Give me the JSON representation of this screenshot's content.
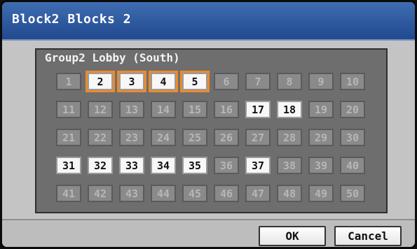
{
  "dialog": {
    "title": "Block2 Blocks 2",
    "group_label": "Group2 Lobby (South)"
  },
  "grid": {
    "units": [
      "1",
      "2",
      "3",
      "4",
      "5",
      "6",
      "7",
      "8",
      "9",
      "10",
      "11",
      "12",
      "13",
      "14",
      "15",
      "16",
      "17",
      "18",
      "19",
      "20",
      "21",
      "22",
      "23",
      "24",
      "25",
      "26",
      "27",
      "28",
      "29",
      "30",
      "31",
      "32",
      "33",
      "34",
      "35",
      "36",
      "37",
      "38",
      "39",
      "40",
      "41",
      "42",
      "43",
      "44",
      "45",
      "46",
      "47",
      "48",
      "49",
      "50"
    ],
    "active": [
      2,
      3,
      4,
      5,
      17,
      18,
      31,
      32,
      33,
      34,
      35,
      37
    ],
    "selected": [
      2,
      3,
      4,
      5
    ]
  },
  "buttons": {
    "ok_label": "OK",
    "cancel_label": "Cancel"
  },
  "colors": {
    "title_bar": "#2f5ea4",
    "selection_outline": "#ec8a2c",
    "panel": "#6e6e6e"
  }
}
